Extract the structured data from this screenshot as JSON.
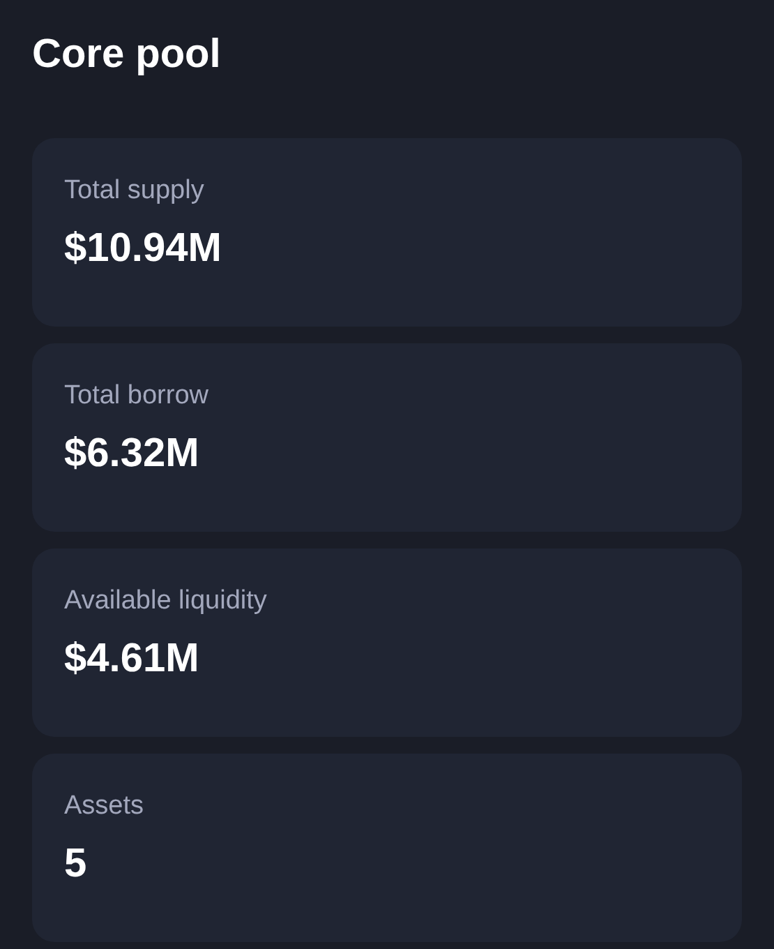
{
  "title": "Core pool",
  "stats": [
    {
      "label": "Total supply",
      "value": "$10.94M"
    },
    {
      "label": "Total borrow",
      "value": "$6.32M"
    },
    {
      "label": "Available liquidity",
      "value": "$4.61M"
    },
    {
      "label": "Assets",
      "value": "5"
    }
  ]
}
